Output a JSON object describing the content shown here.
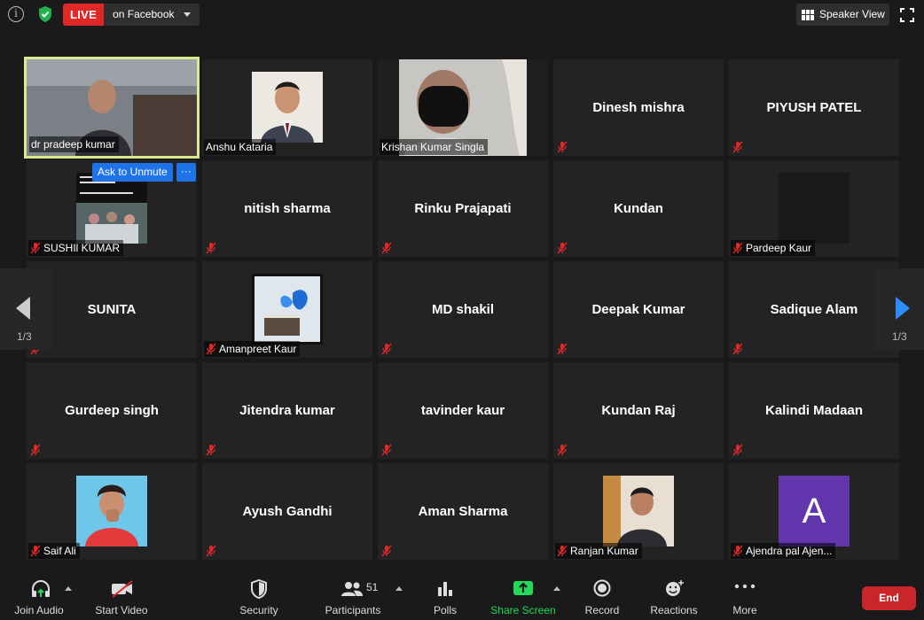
{
  "top_bar": {
    "live_label": "LIVE",
    "live_destination": "on Facebook",
    "speaker_view_label": "Speaker View"
  },
  "unmute_popup": {
    "label": "Ask to Unmute",
    "more": "···"
  },
  "pagination": {
    "left": "1/3",
    "right": "1/3"
  },
  "participants": [
    {
      "name": "dr pradeep kumar",
      "type": "video"
    },
    {
      "name": "Anshu Kataria",
      "type": "photo"
    },
    {
      "name": "Krishan Kumar Singla",
      "type": "video"
    },
    {
      "name": "Dinesh mishra",
      "type": "name",
      "muted": true
    },
    {
      "name": "PIYUSH PATEL",
      "type": "name",
      "muted": true
    },
    {
      "name": "SUSHIl KUMAR",
      "type": "photo",
      "muted": true
    },
    {
      "name": "nitish sharma",
      "type": "name",
      "muted": true
    },
    {
      "name": "Rinku Prajapati",
      "type": "name",
      "muted": true
    },
    {
      "name": "Kundan",
      "type": "name",
      "muted": true
    },
    {
      "name": "Pardeep Kaur",
      "type": "photo",
      "muted": true
    },
    {
      "name": "SUNITA",
      "type": "name",
      "muted": true
    },
    {
      "name": "Amanpreet Kaur",
      "type": "photo",
      "muted": true
    },
    {
      "name": "MD shakil",
      "type": "name",
      "muted": true
    },
    {
      "name": "Deepak Kumar",
      "type": "name",
      "muted": true
    },
    {
      "name": "Sadique Alam",
      "type": "name",
      "muted": true
    },
    {
      "name": "Gurdeep singh",
      "type": "name",
      "muted": true
    },
    {
      "name": "Jitendra kumar",
      "type": "name",
      "muted": true
    },
    {
      "name": "tavinder kaur",
      "type": "name",
      "muted": true
    },
    {
      "name": "Kundan Raj",
      "type": "name",
      "muted": true
    },
    {
      "name": "Kalindi Madaan",
      "type": "name",
      "muted": true
    },
    {
      "name": "Saif Ali",
      "type": "photo",
      "muted": true
    },
    {
      "name": "Ayush Gandhi",
      "type": "name",
      "muted": true
    },
    {
      "name": "Aman Sharma",
      "type": "name",
      "muted": true
    },
    {
      "name": "Ranjan Kumar",
      "type": "photo",
      "muted": true
    },
    {
      "name": "Ajendra pal Ajen...",
      "type": "avatar",
      "avatar_letter": "A",
      "muted": true
    }
  ],
  "toolbar": {
    "join_audio": "Join Audio",
    "start_video": "Start Video",
    "security": "Security",
    "participants": "Participants",
    "participant_count": "51",
    "polls": "Polls",
    "share_screen": "Share Screen",
    "record": "Record",
    "reactions": "Reactions",
    "more": "More",
    "end": "End"
  },
  "colors": {
    "live_red": "#e02828",
    "active_speaker_border": "#d9ea8b",
    "share_green": "#23d959",
    "end_red": "#c8262b",
    "accent_blue": "#2d8cff"
  }
}
